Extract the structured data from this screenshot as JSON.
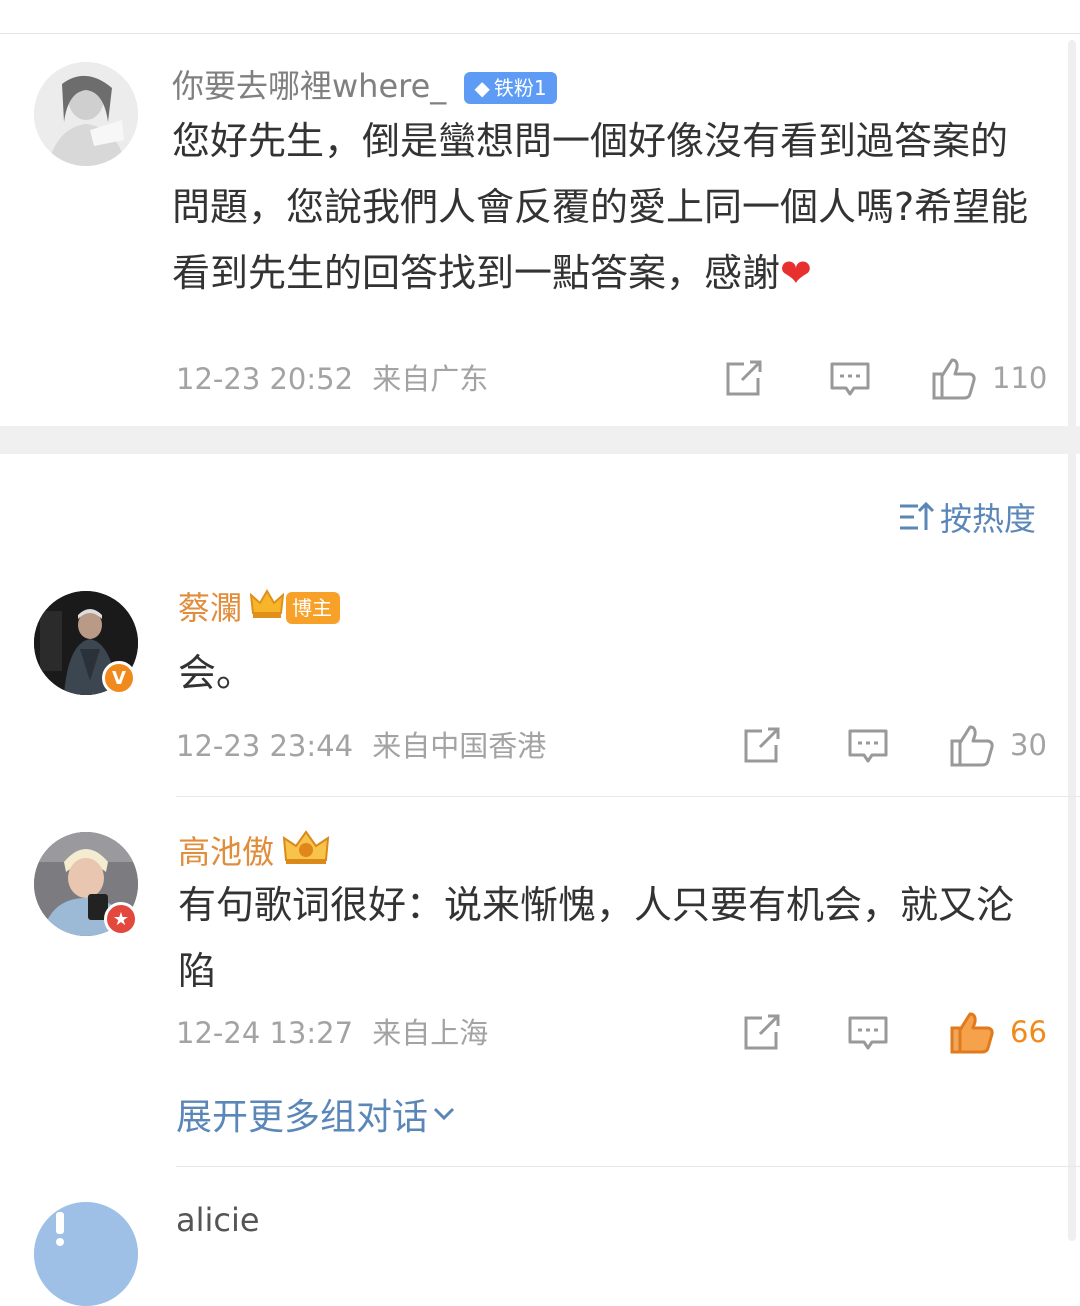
{
  "post": {
    "username": "你要去哪裡where_",
    "badge": "铁粉1",
    "text": "您好先生，倒是蠻想問一個好像沒有看到過答案的問題，您說我們人會反覆的愛上同一個人嗎?希望能看到先生的回答找到一點答案，感謝",
    "emoji": "❤",
    "time": "12-23 20:52",
    "location": "来自广东",
    "likes": "110"
  },
  "sort": {
    "label": "按热度",
    "icon": "sort-icon"
  },
  "comments": [
    {
      "username": "蔡瀾",
      "badge": "博主",
      "text": "会。",
      "time": "12-23 23:44",
      "location": "来自中国香港",
      "likes": "30",
      "liked": false
    },
    {
      "username": "高池傲",
      "text": "有句歌词很好：说来惭愧，人只要有机会，就又沦陷",
      "time": "12-24 13:27",
      "location": "来自上海",
      "likes": "66",
      "liked": true
    }
  ],
  "expand": {
    "label": "展开更多组对话"
  },
  "next_comment": {
    "username": "alicie"
  },
  "colors": {
    "username_orange": "#e08d3c",
    "link_blue": "#5b87b8",
    "meta_gray": "#a3a3a3",
    "like_orange": "#f08a1c"
  }
}
